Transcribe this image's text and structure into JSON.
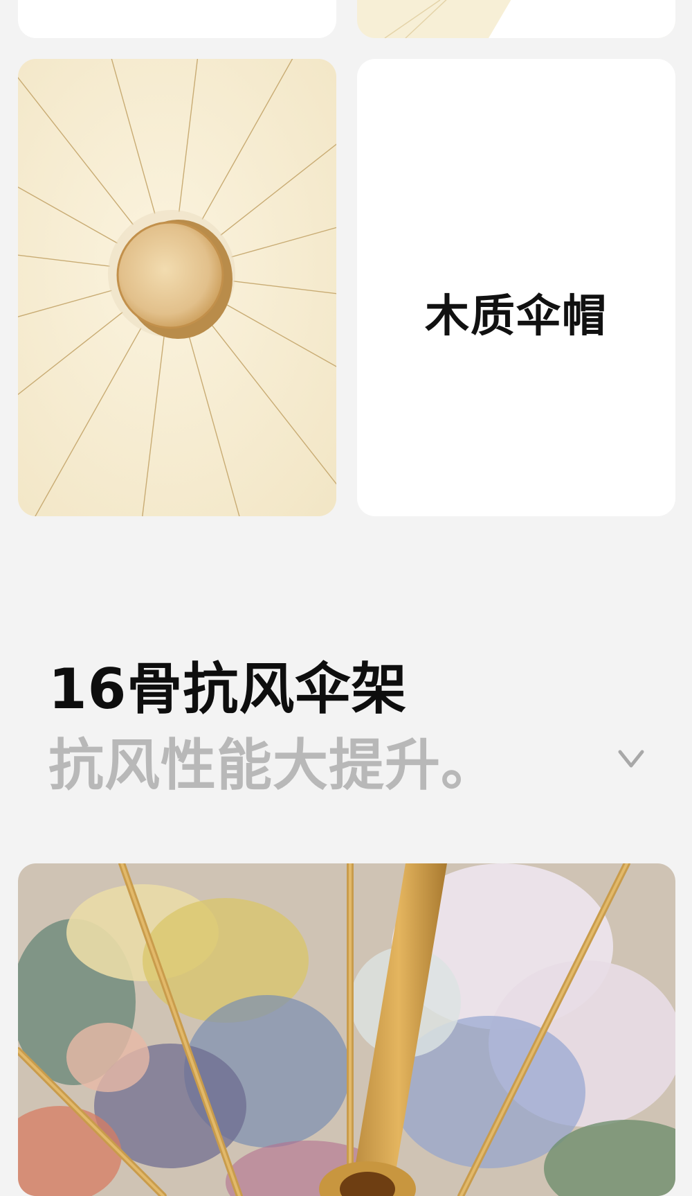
{
  "feature_card": {
    "title": "木质伞帽"
  },
  "section": {
    "headline": "16骨抗风伞架",
    "subline": "抗风性能大提升。",
    "expand_icon": "chevron-down-icon"
  },
  "colors": {
    "page_bg": "#f3f3f3",
    "canopy_cream": "#f8efd8",
    "wood": "#d9b77e",
    "rib_gold": "#c9a256",
    "subline_gray": "#b8b8b8"
  }
}
